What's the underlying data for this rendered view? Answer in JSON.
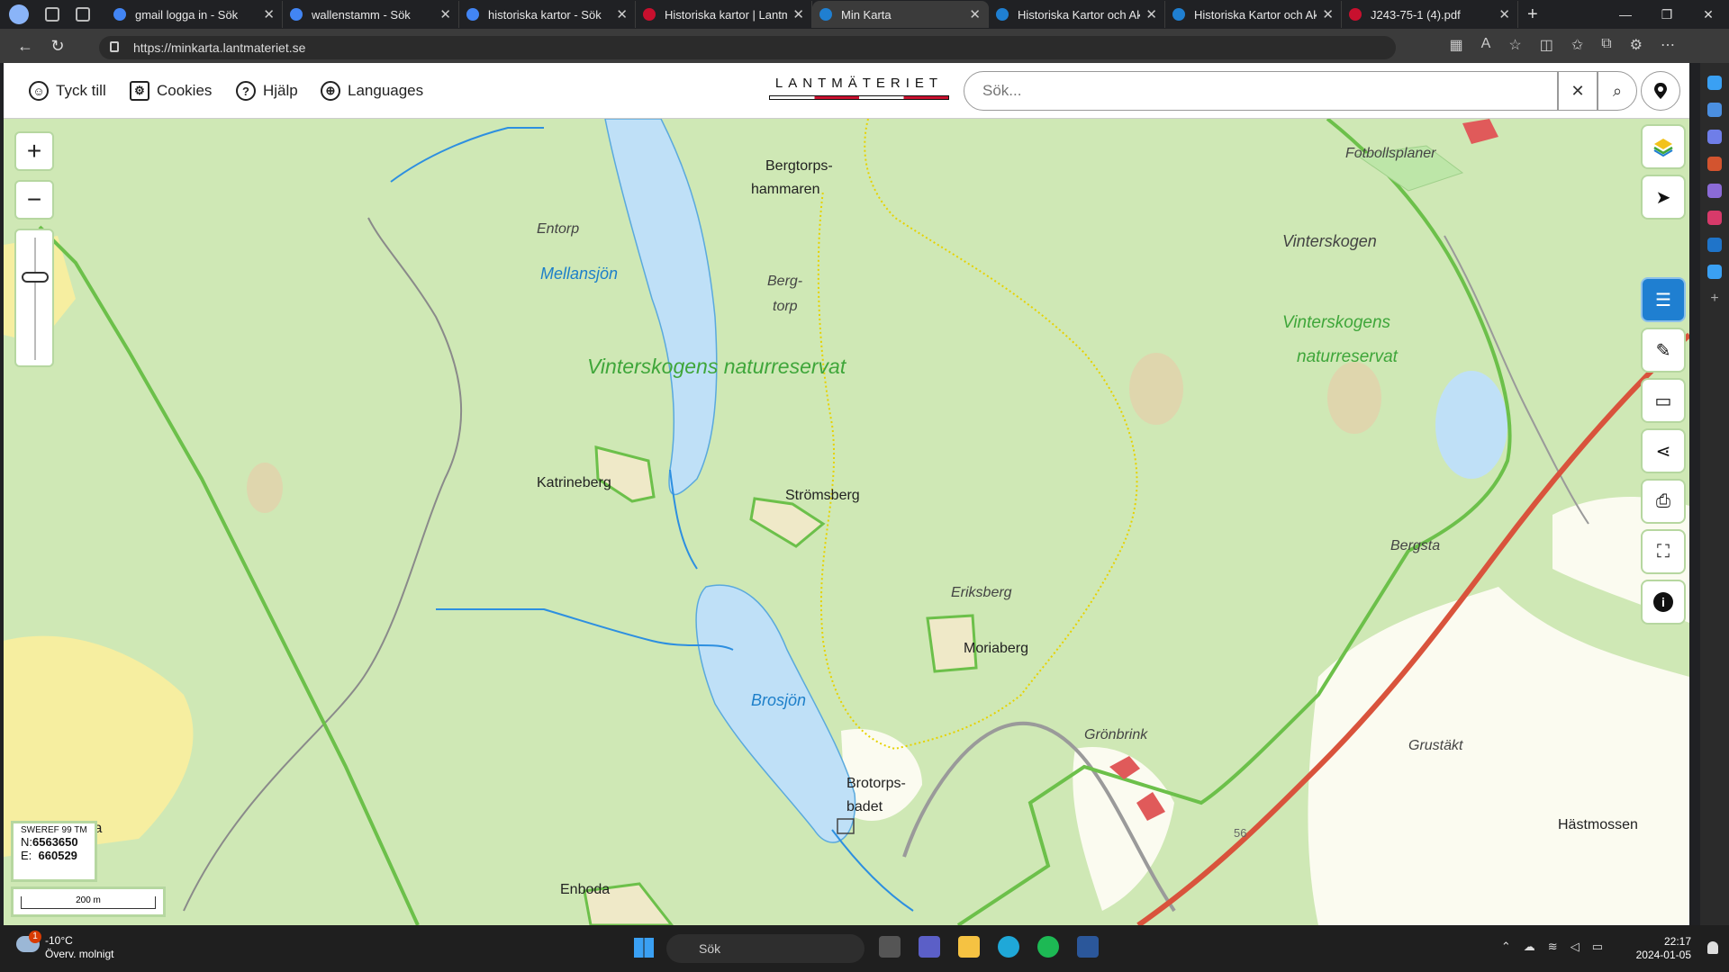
{
  "browser": {
    "tabs": [
      {
        "label": "gmail logga in - Sök",
        "fav": "#4285f4",
        "active": false
      },
      {
        "label": "wallenstamm - Sök",
        "fav": "#4285f4",
        "active": false
      },
      {
        "label": "historiska kartor - Sök",
        "fav": "#4285f4",
        "active": false
      },
      {
        "label": "Historiska kartor | Lantmä",
        "fav": "#c8102e",
        "active": false
      },
      {
        "label": "Min Karta",
        "fav": "#1f7fd1",
        "active": true
      },
      {
        "label": "Historiska Kartor och Akt",
        "fav": "#1f7fd1",
        "active": false
      },
      {
        "label": "Historiska Kartor och Akt",
        "fav": "#1f7fd1",
        "active": false
      },
      {
        "label": "J243-75-1 (4).pdf",
        "fav": "#c8102e",
        "active": false
      }
    ],
    "url": "https://minkarta.lantmateriet.se"
  },
  "header": {
    "feedback": "Tyck till",
    "cookies": "Cookies",
    "help": "Hjälp",
    "languages": "Languages",
    "logo": "LANTMÄTERIET",
    "search_placeholder": "Sök..."
  },
  "map": {
    "labels": {
      "bergtorpshammaren_1": "Bergtorps-",
      "bergtorpshammaren_2": "hammaren",
      "entorp": "Entorp",
      "mellansjon": "Mellansjön",
      "bergtorp_1": "Berg-",
      "bergtorp_2": "torp",
      "reserve_main": "Vinterskogens naturreservat",
      "vinterskogen": "Vinterskogen",
      "reserve_right_1": "Vinterskogens",
      "reserve_right_2": "naturreservat",
      "fotbollsplaner": "Fotbollsplaner",
      "katrineberg": "Katrineberg",
      "stromsberg": "Strömsberg",
      "eriksberg": "Eriksberg",
      "moriaberg": "Moriaberg",
      "bergsta": "Bergsta",
      "brosjon": "Brosjön",
      "gronbrink": "Grönbrink",
      "grustakt": "Grustäkt",
      "brotorpsbadet_1": "Brotorps-",
      "brotorpsbadet_2": "badet",
      "hastmossen": "Hästmossen",
      "enboda": "Enboda",
      "partial_ta": "ta",
      "road_56": "56"
    },
    "coords": {
      "system": "SWEREF 99 TM",
      "n_label": "N:",
      "n": "6563650",
      "e_label": "E:",
      "e": "660529"
    },
    "scale": "200 m",
    "colors": {
      "forest": "#cfe8b5",
      "water": "#bfe0f7",
      "reserve_border": "#6cc04a",
      "road": "#d9533c",
      "field": "#f7f0a6"
    }
  },
  "taskbar": {
    "temp": "-10°C",
    "weather": "Överv. molnigt",
    "badge": "1",
    "search": "Sök",
    "time": "22:17",
    "date": "2024-01-05"
  }
}
